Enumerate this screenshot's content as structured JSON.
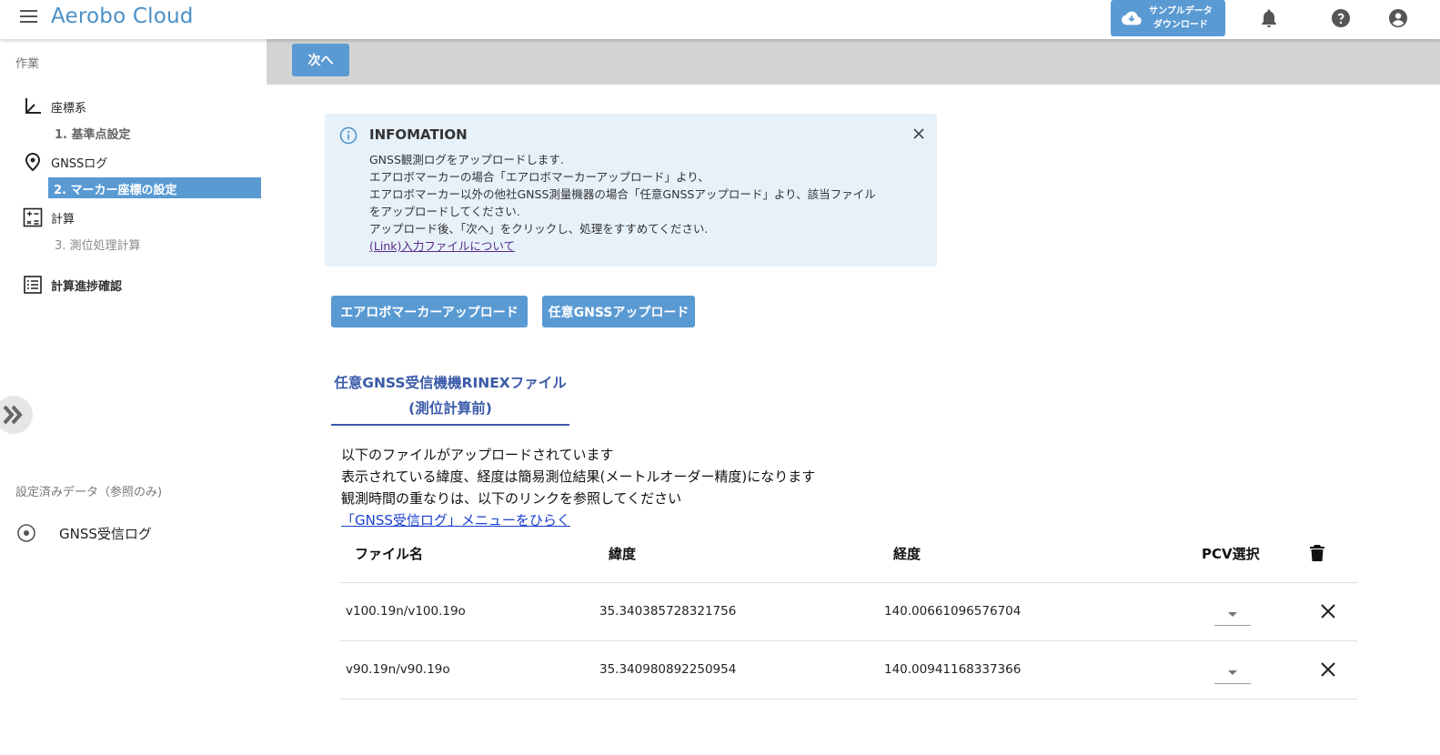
{
  "header": {
    "app_title": "Aerobo Cloud",
    "download_button": "サンプルデータ\nダウンロード",
    "icons": [
      "menu-icon",
      "cloud-download-icon",
      "bell-icon",
      "help-icon",
      "account-icon"
    ]
  },
  "sidebar": {
    "section_work": "作業",
    "items": [
      {
        "label": "座標系",
        "icon": "axis-icon"
      },
      {
        "label": "GNSSログ",
        "icon": "location-pin-icon"
      },
      {
        "label": "計算",
        "icon": "calculator-icon"
      },
      {
        "label": "計算進捗確認",
        "icon": "list-icon"
      }
    ],
    "steps": [
      {
        "label": "1. 基準点設定",
        "state": "done"
      },
      {
        "label": "2. マーカー座標の設定",
        "state": "active"
      },
      {
        "label": "3. 測位処理計算",
        "state": "pending"
      }
    ],
    "section_configured": "設定済みデータ（参照のみ)",
    "configured_item": "GNSS受信ログ"
  },
  "actionbar": {
    "next_label": "次へ"
  },
  "info": {
    "title": "INFOMATION",
    "lines": [
      "GNSS観測ログをアップロードします.",
      "エアロボマーカーの場合「エアロボマーカーアップロード」より、",
      "エアロボマーカー以外の他社GNSS測量機器の場合「任意GNSSアップロード」より、該当ファイル",
      "をアップロードしてください.",
      "アップロード後、「次へ」をクリックし、処理をすすめてください."
    ],
    "link": "(Link)入力ファイルについて"
  },
  "upload": {
    "aerobo_label": "エアロボマーカーアップロード",
    "gnss_label": "任意GNSSアップロード"
  },
  "tab": {
    "title_line1": "任意GNSS受信機機RINEXファイル",
    "title_line2": "(測位計算前)"
  },
  "description": {
    "line1": "以下のファイルがアップロードされています",
    "line2": "表示されている緯度、経度は簡易測位結果(メートルオーダー精度)になります",
    "line3": "観測時間の重なりは、以下のリンクを参照してください",
    "link": "「GNSS受信ログ」メニューをひらく"
  },
  "table": {
    "headers": {
      "filename": "ファイル名",
      "lat": "緯度",
      "lon": "経度",
      "pcv": "PCV選択"
    },
    "rows": [
      {
        "filename": "v100.19n/v100.19o",
        "lat": "35.340385728321756",
        "lon": "140.00661096576704"
      },
      {
        "filename": "v90.19n/v90.19o",
        "lat": "35.340980892250954",
        "lon": "140.00941168337366"
      }
    ]
  }
}
